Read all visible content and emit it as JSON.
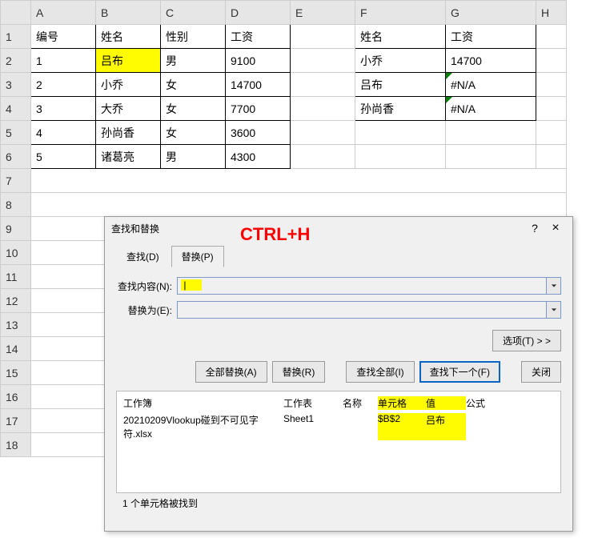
{
  "columns": [
    "A",
    "B",
    "C",
    "D",
    "E",
    "F",
    "G",
    "H"
  ],
  "rows": [
    "1",
    "2",
    "3",
    "4",
    "5",
    "6",
    "7",
    "8",
    "9",
    "10",
    "11",
    "12",
    "13",
    "14",
    "15",
    "16",
    "17",
    "18"
  ],
  "table1": {
    "headers": [
      "编号",
      "姓名",
      "性别",
      "工资"
    ],
    "data": [
      [
        "1",
        "吕布",
        "男",
        "9100"
      ],
      [
        "2",
        "小乔",
        "女",
        "14700"
      ],
      [
        "3",
        "大乔",
        "女",
        "7700"
      ],
      [
        "4",
        "孙尚香",
        "女",
        "3600"
      ],
      [
        "5",
        "诸葛亮",
        "男",
        "4300"
      ]
    ]
  },
  "table2": {
    "headers": [
      "姓名",
      "工资"
    ],
    "data": [
      [
        "小乔",
        "14700"
      ],
      [
        "吕布",
        "#N/A"
      ],
      [
        "孙尚香",
        "#N/A"
      ]
    ]
  },
  "annotation": "CTRL+H",
  "dialog": {
    "title": "查找和替换",
    "help": "?",
    "close": "×",
    "tabs": {
      "find": "查找(D)",
      "replace": "替换(P)"
    },
    "fields": {
      "find_label": "查找内容(N):",
      "find_value": "",
      "replace_label": "替换为(E):",
      "replace_value": ""
    },
    "options_btn": "选项(T) > >",
    "buttons": {
      "replace_all": "全部替换(A)",
      "replace": "替换(R)",
      "find_all": "查找全部(I)",
      "find_next": "查找下一个(F)",
      "close": "关闭"
    },
    "results": {
      "headers": {
        "workbook": "工作簿",
        "worksheet": "工作表",
        "name": "名称",
        "cell": "单元格",
        "value": "值",
        "formula": "公式"
      },
      "row": {
        "workbook": "20210209Vlookup碰到不可见字符.xlsx",
        "worksheet": "Sheet1",
        "name": "",
        "cell": "$B$2",
        "value": "吕布",
        "formula": ""
      }
    },
    "status": "1 个单元格被找到"
  },
  "chart_data": {
    "type": "table",
    "tables": [
      {
        "columns": [
          "编号",
          "姓名",
          "性别",
          "工资"
        ],
        "rows": [
          [
            "1",
            "吕布",
            "男",
            9100
          ],
          [
            "2",
            "小乔",
            "女",
            14700
          ],
          [
            "3",
            "大乔",
            "女",
            7700
          ],
          [
            "4",
            "孙尚香",
            "女",
            3600
          ],
          [
            "5",
            "诸葛亮",
            "男",
            4300
          ]
        ]
      },
      {
        "columns": [
          "姓名",
          "工资"
        ],
        "rows": [
          [
            "小乔",
            14700
          ],
          [
            "吕布",
            "#N/A"
          ],
          [
            "孙尚香",
            "#N/A"
          ]
        ]
      }
    ]
  }
}
